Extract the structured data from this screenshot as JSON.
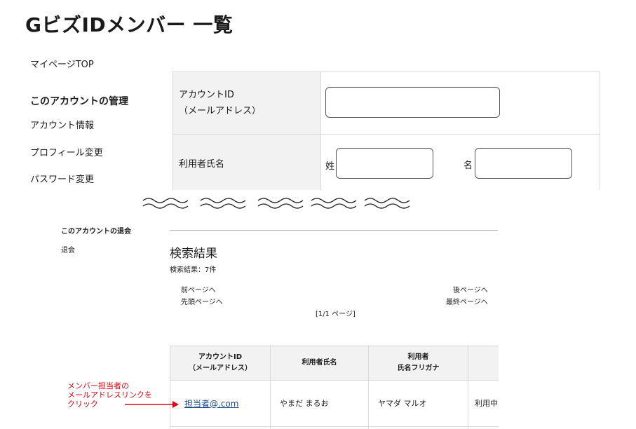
{
  "page": {
    "title": "GビズIDメンバー 一覧"
  },
  "sidebar": {
    "mypage_top": "マイページTOP",
    "account_section_title": "このアカウントの管理",
    "items": [
      {
        "label": "アカウント情報"
      },
      {
        "label": "プロフィール変更"
      },
      {
        "label": "パスワード変更"
      }
    ],
    "withdraw_section_title": "このアカウントの退会",
    "withdraw_item": "退会"
  },
  "search_form": {
    "account_id_label_line1": "アカウントID",
    "account_id_label_line2": "（メールアドレス）",
    "account_id_value": "",
    "name_label": "利用者氏名",
    "last_name_label": "姓",
    "last_name_value": "",
    "first_name_label": "名",
    "first_name_value": ""
  },
  "results": {
    "title": "検索結果",
    "count_text": "検索結果：7件",
    "pager": {
      "prev": "前ページへ",
      "first": "先頭ページへ",
      "next": "後ページへ",
      "last": "最終ページへ",
      "page_info": "[1/1 ページ]"
    },
    "columns": [
      {
        "label": "アカウントID\n（メールアドレス）"
      },
      {
        "label": "利用者氏名"
      },
      {
        "label": "利用者\n氏名フリガナ"
      },
      {
        "label": ""
      }
    ],
    "rows": [
      {
        "email": "担当者@.com",
        "name": "やまだ まるお",
        "furigana": "ヤマダ マルオ",
        "status": "利用中"
      }
    ]
  },
  "annotation": {
    "text": "メンバー担当者の\nメールアドレスリンクを\nクリック",
    "color": "#e60012"
  },
  "colors": {
    "link": "#1a4a8a",
    "header_bg": "#f2f2f2",
    "border": "#d9d9d9"
  },
  "icons": {
    "break_mark": "wavy-break-icon",
    "pointer": "red-arrow-icon"
  }
}
